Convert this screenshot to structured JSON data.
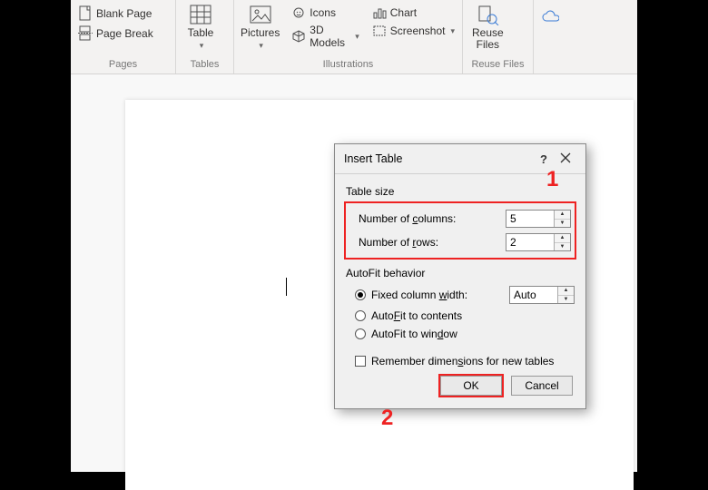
{
  "ribbon": {
    "pages": {
      "label": "Pages",
      "blank_page": "Blank Page",
      "page_break": "Page Break"
    },
    "tables": {
      "label": "Tables",
      "table": "Table"
    },
    "illustrations": {
      "label": "Illustrations",
      "pictures": "Pictures",
      "icons": "Icons",
      "models": "3D Models",
      "chart": "Chart",
      "screenshot": "Screenshot"
    },
    "reuse": {
      "label": "Reuse Files",
      "btn": "Reuse\nFiles"
    }
  },
  "dialog": {
    "title": "Insert Table",
    "table_size": "Table size",
    "cols_label": "Number of columns:",
    "cols_value": "5",
    "rows_label": "Number of rows:",
    "rows_value": "2",
    "autofit_label": "AutoFit behavior",
    "fixed_label": "Fixed column width:",
    "fixed_value": "Auto",
    "fit_contents": "AutoFit to contents",
    "fit_window": "AutoFit to window",
    "remember": "Remember dimensions for new tables",
    "ok": "OK",
    "cancel": "Cancel"
  },
  "annotations": {
    "a1": "1",
    "a2": "2"
  }
}
